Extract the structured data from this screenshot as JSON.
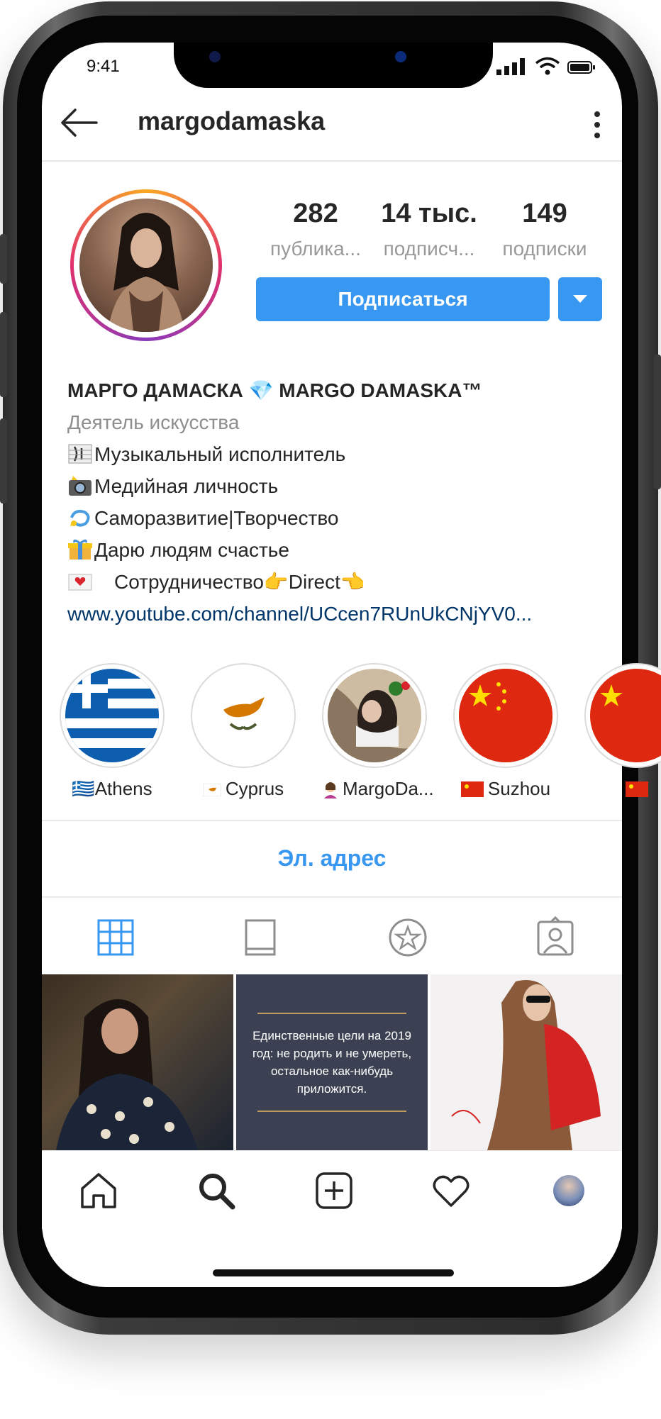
{
  "status_bar": {
    "time": "9:41"
  },
  "header": {
    "username": "margodamaska"
  },
  "stats": [
    {
      "value": "282",
      "label": "публика..."
    },
    {
      "value": "14 тыс.",
      "label": "подписч..."
    },
    {
      "value": "149",
      "label": "подписки"
    }
  ],
  "follow_button": {
    "label": "Подписаться"
  },
  "bio": {
    "name": "МАРГО ДАМАСКА 💎 MARGO DAMASKA™",
    "category": "Деятель искусства",
    "lines": [
      "Музыкальный исполнитель",
      "Медийная личность",
      "Саморазвитие|Творчество",
      "Дарю людям счастье",
      "Сотрудничество👉Direct👈"
    ],
    "link": "www.youtube.com/channel/UCcen7RUnUkCNjYV0..."
  },
  "highlights": [
    {
      "label": "🇬🇷Athens"
    },
    {
      "label": "Cyprus"
    },
    {
      "label": "MargoDa..."
    },
    {
      "label": "Suzhou"
    }
  ],
  "email_button": {
    "label": "Эл. адрес"
  },
  "grid": {
    "quote": "Единственные цели на 2019 год: не родить и не умереть, остальное как-нибудь приложится."
  },
  "colors": {
    "accent": "#3897f0",
    "text": "#262626",
    "muted": "#999999",
    "link": "#003569"
  },
  "icons": {
    "header": [
      "back-arrow-icon",
      "more-vertical-icon"
    ],
    "tabs": [
      "grid-icon",
      "feed-icon",
      "star-icon",
      "tagged-user-icon"
    ],
    "bottom_nav": [
      "home-icon",
      "search-icon",
      "add-post-icon",
      "heart-icon",
      "profile-avatar"
    ]
  }
}
